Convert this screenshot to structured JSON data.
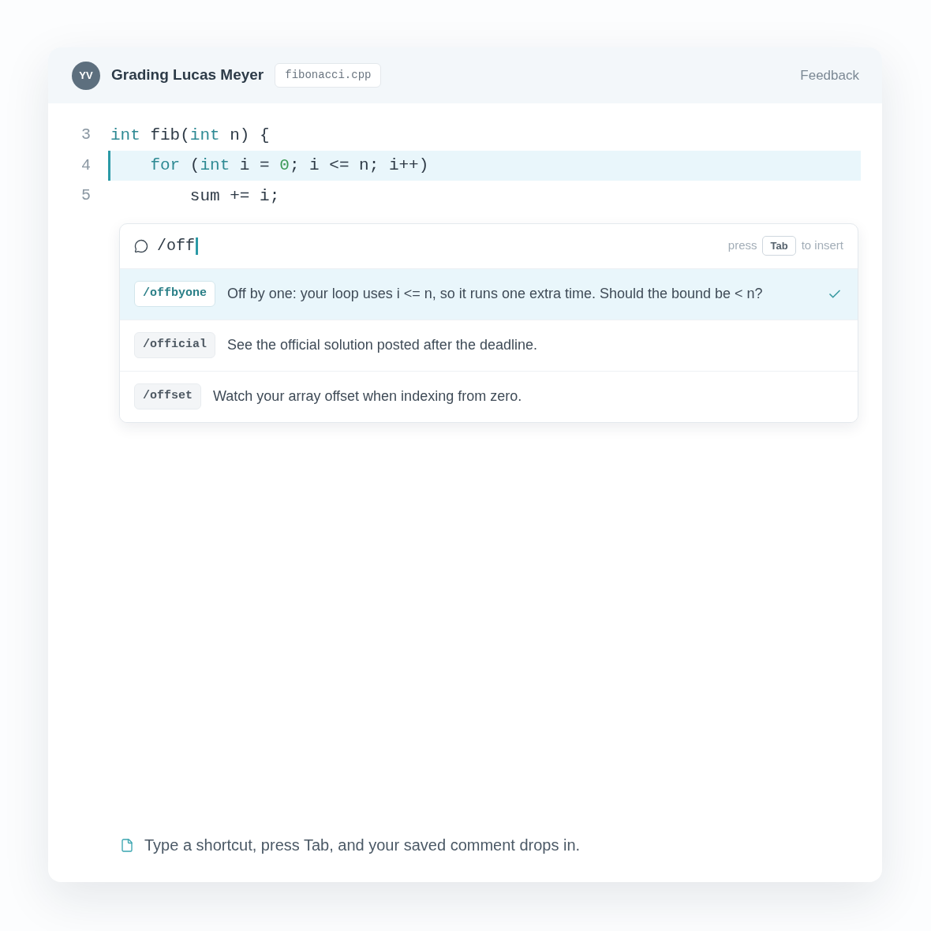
{
  "header": {
    "avatar_initials": "YV",
    "title": "Grading Lucas Meyer",
    "file": "fibonacci.cpp",
    "action": "Feedback"
  },
  "code": {
    "lines": [
      {
        "number": "3",
        "highlighted": false,
        "tokens": [
          {
            "text": "int",
            "kind": "keyword"
          },
          {
            "text": " fib(",
            "kind": "plain"
          },
          {
            "text": "int",
            "kind": "keyword"
          },
          {
            "text": " n) {",
            "kind": "plain"
          }
        ]
      },
      {
        "number": "4",
        "highlighted": true,
        "tokens": [
          {
            "text": "    for",
            "kind": "keyword"
          },
          {
            "text": " (",
            "kind": "plain"
          },
          {
            "text": "int",
            "kind": "keyword"
          },
          {
            "text": " i = ",
            "kind": "plain"
          },
          {
            "text": "0",
            "kind": "number"
          },
          {
            "text": "; i <= n; i++)",
            "kind": "plain"
          }
        ]
      },
      {
        "number": "5",
        "highlighted": false,
        "tokens": [
          {
            "text": "        sum += i;",
            "kind": "plain"
          }
        ]
      }
    ]
  },
  "autocomplete": {
    "query": "/off",
    "hint": {
      "before": "press",
      "key": "Tab",
      "after": "to insert"
    },
    "suggestions": [
      {
        "shortcut": "/offbyone",
        "text": "Off by one: your loop uses i <= n, so it runs one extra time. Should the bound be < n?",
        "selected": true
      },
      {
        "shortcut": "/official",
        "text": "See the official solution posted after the deadline.",
        "selected": false
      },
      {
        "shortcut": "/offset",
        "text": "Watch your array offset when indexing from zero.",
        "selected": false
      }
    ]
  },
  "footer": {
    "text": "Type a shortcut, press Tab, and your saved comment drops in."
  }
}
